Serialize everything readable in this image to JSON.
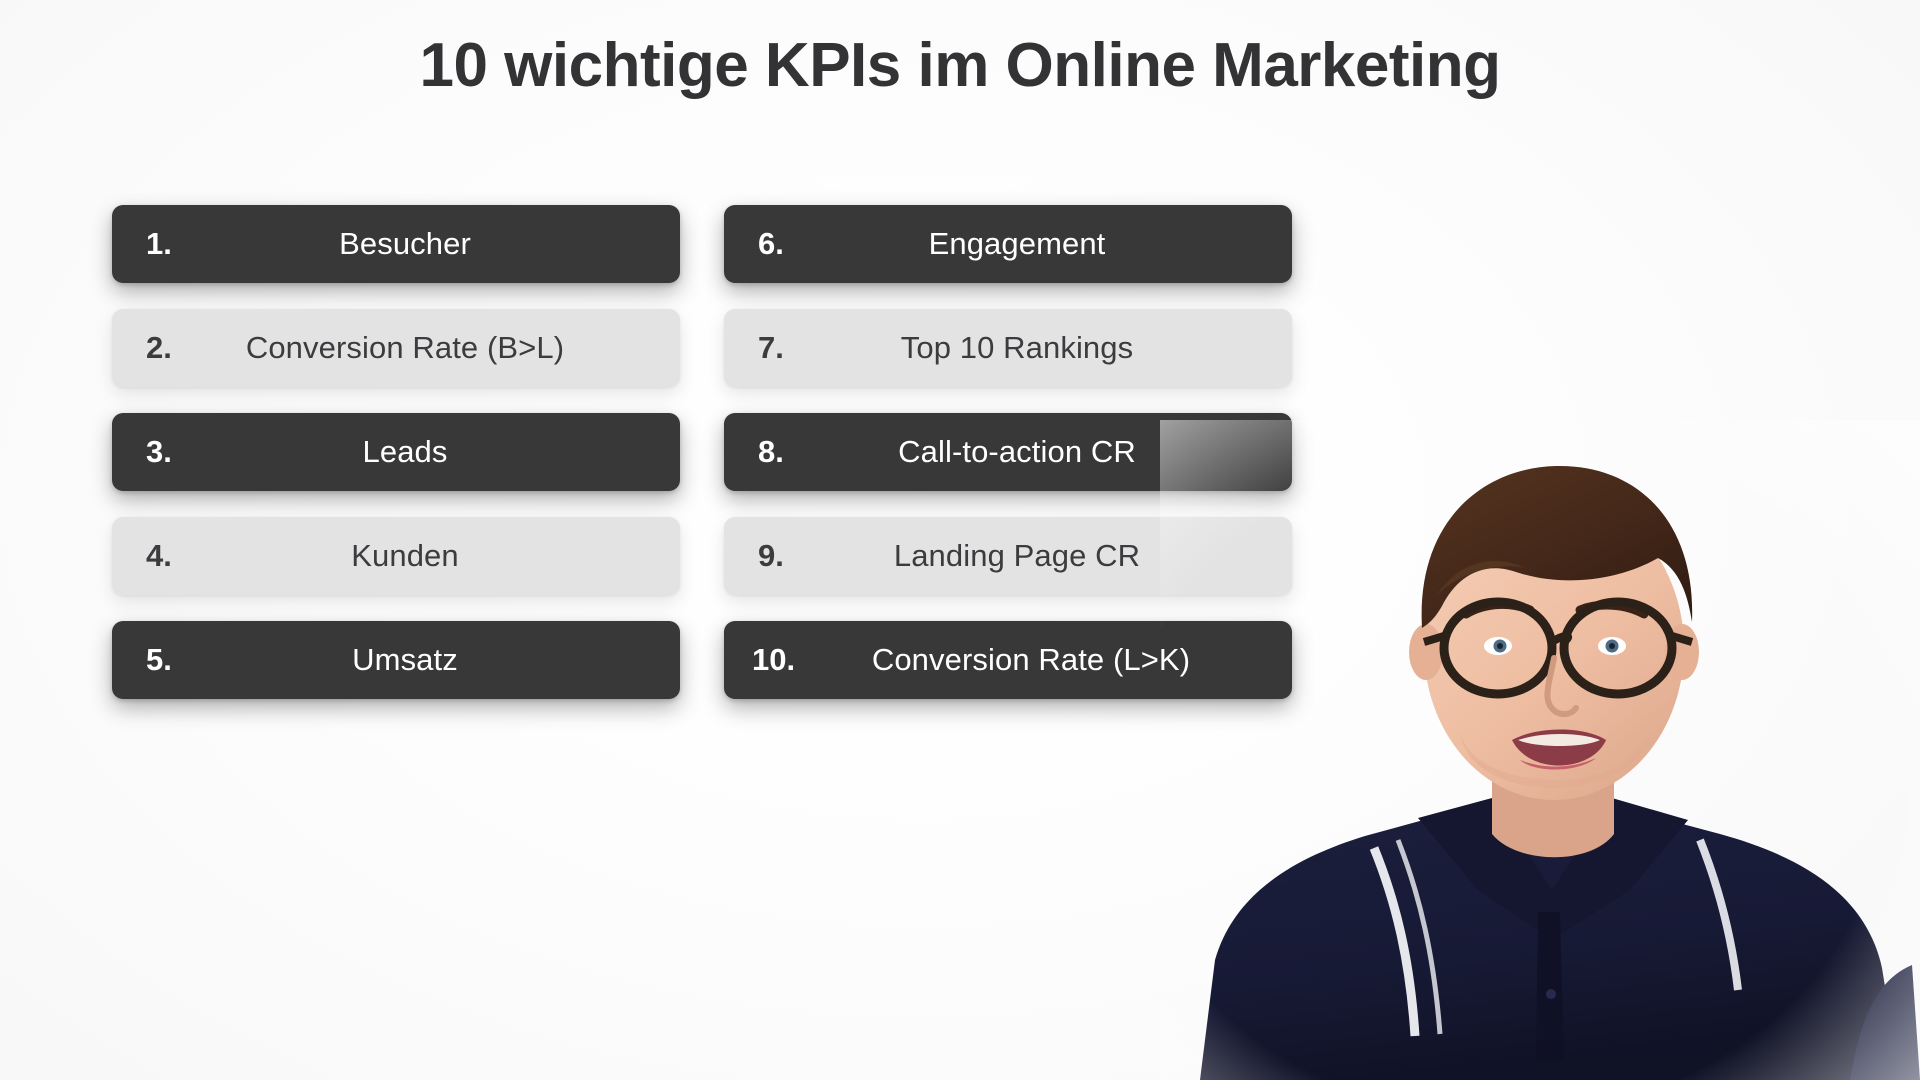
{
  "slide": {
    "title": "10 wichtige KPIs im Online Marketing",
    "background_color": "#ffffff",
    "title_color": "#333336",
    "dark_bar_color": "#383838",
    "light_bar_color": "#e3e3e4",
    "dark_bar_text_color": "#ffffff",
    "light_bar_text_color": "#3c3c3f"
  },
  "kpis": [
    {
      "number": "1.",
      "label": "Besucher",
      "style": "dark"
    },
    {
      "number": "2.",
      "label": "Conversion Rate (B>L)",
      "style": "light"
    },
    {
      "number": "3.",
      "label": "Leads",
      "style": "dark"
    },
    {
      "number": "4.",
      "label": "Kunden",
      "style": "light"
    },
    {
      "number": "5.",
      "label": "Umsatz",
      "style": "dark"
    },
    {
      "number": "6.",
      "label": "Engagement",
      "style": "dark"
    },
    {
      "number": "7.",
      "label": "Top 10 Rankings",
      "style": "light"
    },
    {
      "number": "8.",
      "label": "Call-to-action CR",
      "style": "dark"
    },
    {
      "number": "9.",
      "label": "Landing Page CR",
      "style": "light"
    },
    {
      "number": "10.",
      "label": "Conversion Rate (L>K)",
      "style": "dark"
    }
  ],
  "presenter": {
    "description": "presenter-video-overlay",
    "shirt_color": "#181b38",
    "collar_stripe_color": "#f2f3f7",
    "hair_color": "#42281a",
    "skin_color": "#efbfa4",
    "glasses_color": "#2b2119"
  }
}
